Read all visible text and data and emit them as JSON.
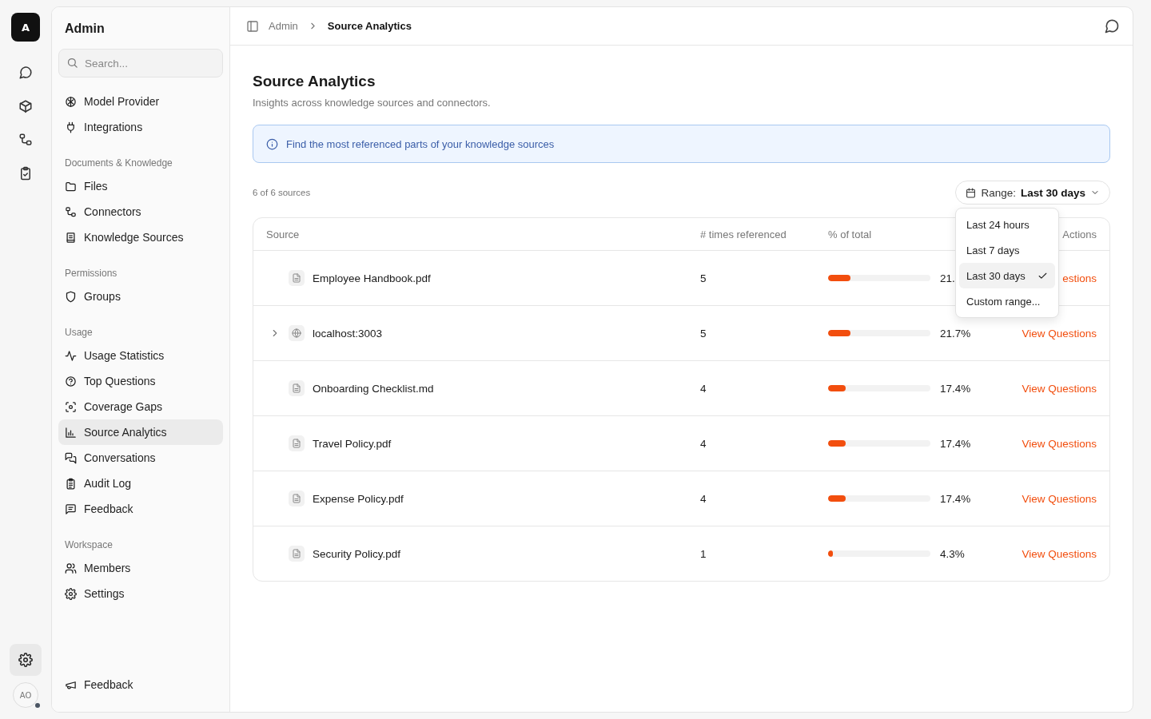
{
  "rail": {
    "logo": "A",
    "avatar": "AO"
  },
  "sidebar": {
    "title": "Admin",
    "search": {
      "placeholder": "Search..."
    },
    "sections": [
      {
        "items": [
          {
            "label": "Model Provider",
            "selected": false
          },
          {
            "label": "Integrations",
            "selected": false
          }
        ]
      },
      {
        "heading": "Documents & Knowledge",
        "items": [
          {
            "label": "Files",
            "selected": false
          },
          {
            "label": "Connectors",
            "selected": false
          },
          {
            "label": "Knowledge Sources",
            "selected": false
          }
        ]
      },
      {
        "heading": "Permissions",
        "items": [
          {
            "label": "Groups",
            "selected": false
          }
        ]
      },
      {
        "heading": "Usage",
        "items": [
          {
            "label": "Usage Statistics",
            "selected": false
          },
          {
            "label": "Top Questions",
            "selected": false
          },
          {
            "label": "Coverage Gaps",
            "selected": false
          },
          {
            "label": "Source Analytics",
            "selected": true
          },
          {
            "label": "Conversations",
            "selected": false
          },
          {
            "label": "Audit Log",
            "selected": false
          },
          {
            "label": "Feedback",
            "selected": false
          }
        ]
      },
      {
        "heading": "Workspace",
        "items": [
          {
            "label": "Members",
            "selected": false
          },
          {
            "label": "Settings",
            "selected": false
          }
        ]
      }
    ],
    "footer": "Feedback"
  },
  "breadcrumb": [
    "Admin",
    "Source Analytics"
  ],
  "page": {
    "title": "Source Analytics",
    "subtitle": "Insights across knowledge sources and connectors.",
    "info": "Find the most referenced parts of your knowledge sources",
    "count": "6 of 6 sources",
    "range": {
      "label": "Range:",
      "value": "Last 30 days",
      "options": [
        {
          "label": "Last 24 hours",
          "selected": false
        },
        {
          "label": "Last 7 days",
          "selected": false
        },
        {
          "label": "Last 30 days",
          "selected": true
        },
        {
          "label": "Custom range...",
          "selected": false
        }
      ]
    }
  },
  "table": {
    "columns": [
      "Source",
      "# times referenced",
      "% of total",
      "Actions"
    ],
    "rows": [
      {
        "kind": "file",
        "source": "Employee Handbook.pdf",
        "times": "5",
        "level": 0.217,
        "percent": "21.",
        "action": "estions"
      },
      {
        "kind": "web",
        "source": "localhost:3003",
        "times": "5",
        "level": 0.217,
        "percent": "21.7%",
        "action": "View Questions"
      },
      {
        "kind": "file",
        "source": "Onboarding Checklist.md",
        "times": "4",
        "level": 0.174,
        "percent": "17.4%",
        "action": "View Questions"
      },
      {
        "kind": "file",
        "source": "Travel Policy.pdf",
        "times": "4",
        "level": 0.174,
        "percent": "17.4%",
        "action": "View Questions"
      },
      {
        "kind": "file",
        "source": "Expense Policy.pdf",
        "times": "4",
        "level": 0.174,
        "percent": "17.4%",
        "action": "View Questions"
      },
      {
        "kind": "file",
        "source": "Security Policy.pdf",
        "times": "1",
        "level": 0.043,
        "percent": "4.3%",
        "action": "View Questions"
      }
    ]
  }
}
